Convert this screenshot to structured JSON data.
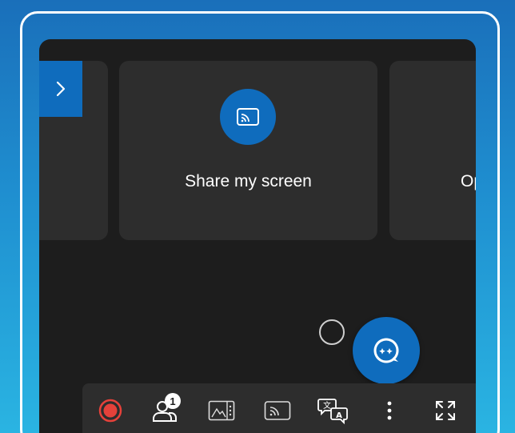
{
  "share_card": {
    "label": "Share my screen",
    "icon": "cast-screen-icon"
  },
  "next_card": {
    "label_visible": "Op"
  },
  "sidebar_toggle": {
    "icon": "chevron-right-icon"
  },
  "copilot_button": {
    "icon": "copilot-chat-icon"
  },
  "toolbar": {
    "participants_count": "1",
    "items": [
      {
        "name": "record-button",
        "icon": "record-icon"
      },
      {
        "name": "participants-button",
        "icon": "people-icon"
      },
      {
        "name": "background-button",
        "icon": "image-icon"
      },
      {
        "name": "cast-button",
        "icon": "cast-icon"
      },
      {
        "name": "translate-button",
        "icon": "translate-icon"
      },
      {
        "name": "more-options-button",
        "icon": "more-vertical-icon"
      },
      {
        "name": "fullscreen-button",
        "icon": "expand-icon"
      }
    ]
  },
  "colors": {
    "accent": "#0f6cbd",
    "record": "#e5413a",
    "surface": "#2d2d2d",
    "background": "#1d1d1d"
  }
}
